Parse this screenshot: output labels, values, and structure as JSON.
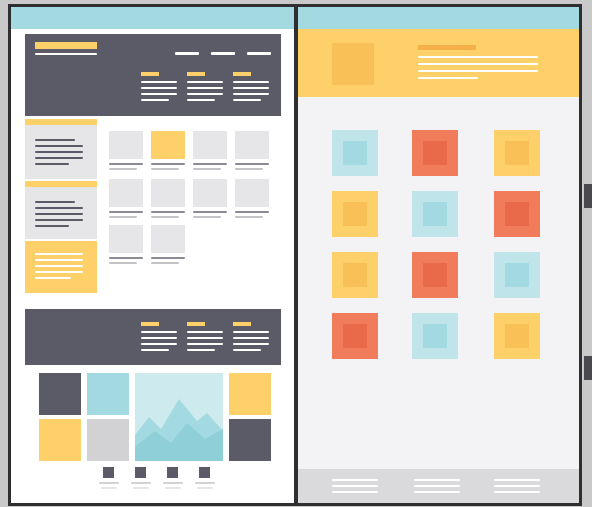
{
  "colors": {
    "teal": "#a3d9e0",
    "dark": "#5a5b66",
    "yellow": "#fdd06a",
    "coral": "#f17c5c",
    "light_gray": "#e6e6e8",
    "mid_gray": "#d2d2d4",
    "bg_gray": "#f3f3f5"
  },
  "left_panel": {
    "name": "landing-page-wireframe",
    "nav_items": 3,
    "feature_columns": 3,
    "side_cards": [
      "gray",
      "gray",
      "yellow"
    ],
    "thumbnail_grid": {
      "rows": 3,
      "cols": 4,
      "highlighted": [
        1
      ]
    },
    "gallery": [
      "dark",
      "teal",
      "mountain-image",
      "yellow",
      "yellow",
      "gray",
      "dark"
    ],
    "pagination_dots": 4
  },
  "right_panel": {
    "name": "tile-grid-wireframe",
    "tiles": [
      [
        "teal",
        "coral",
        "yellow"
      ],
      [
        "yellow",
        "teal",
        "coral"
      ],
      [
        "yellow",
        "coral",
        "teal"
      ],
      [
        "coral",
        "teal",
        "yellow"
      ]
    ],
    "footer_columns": 3
  }
}
